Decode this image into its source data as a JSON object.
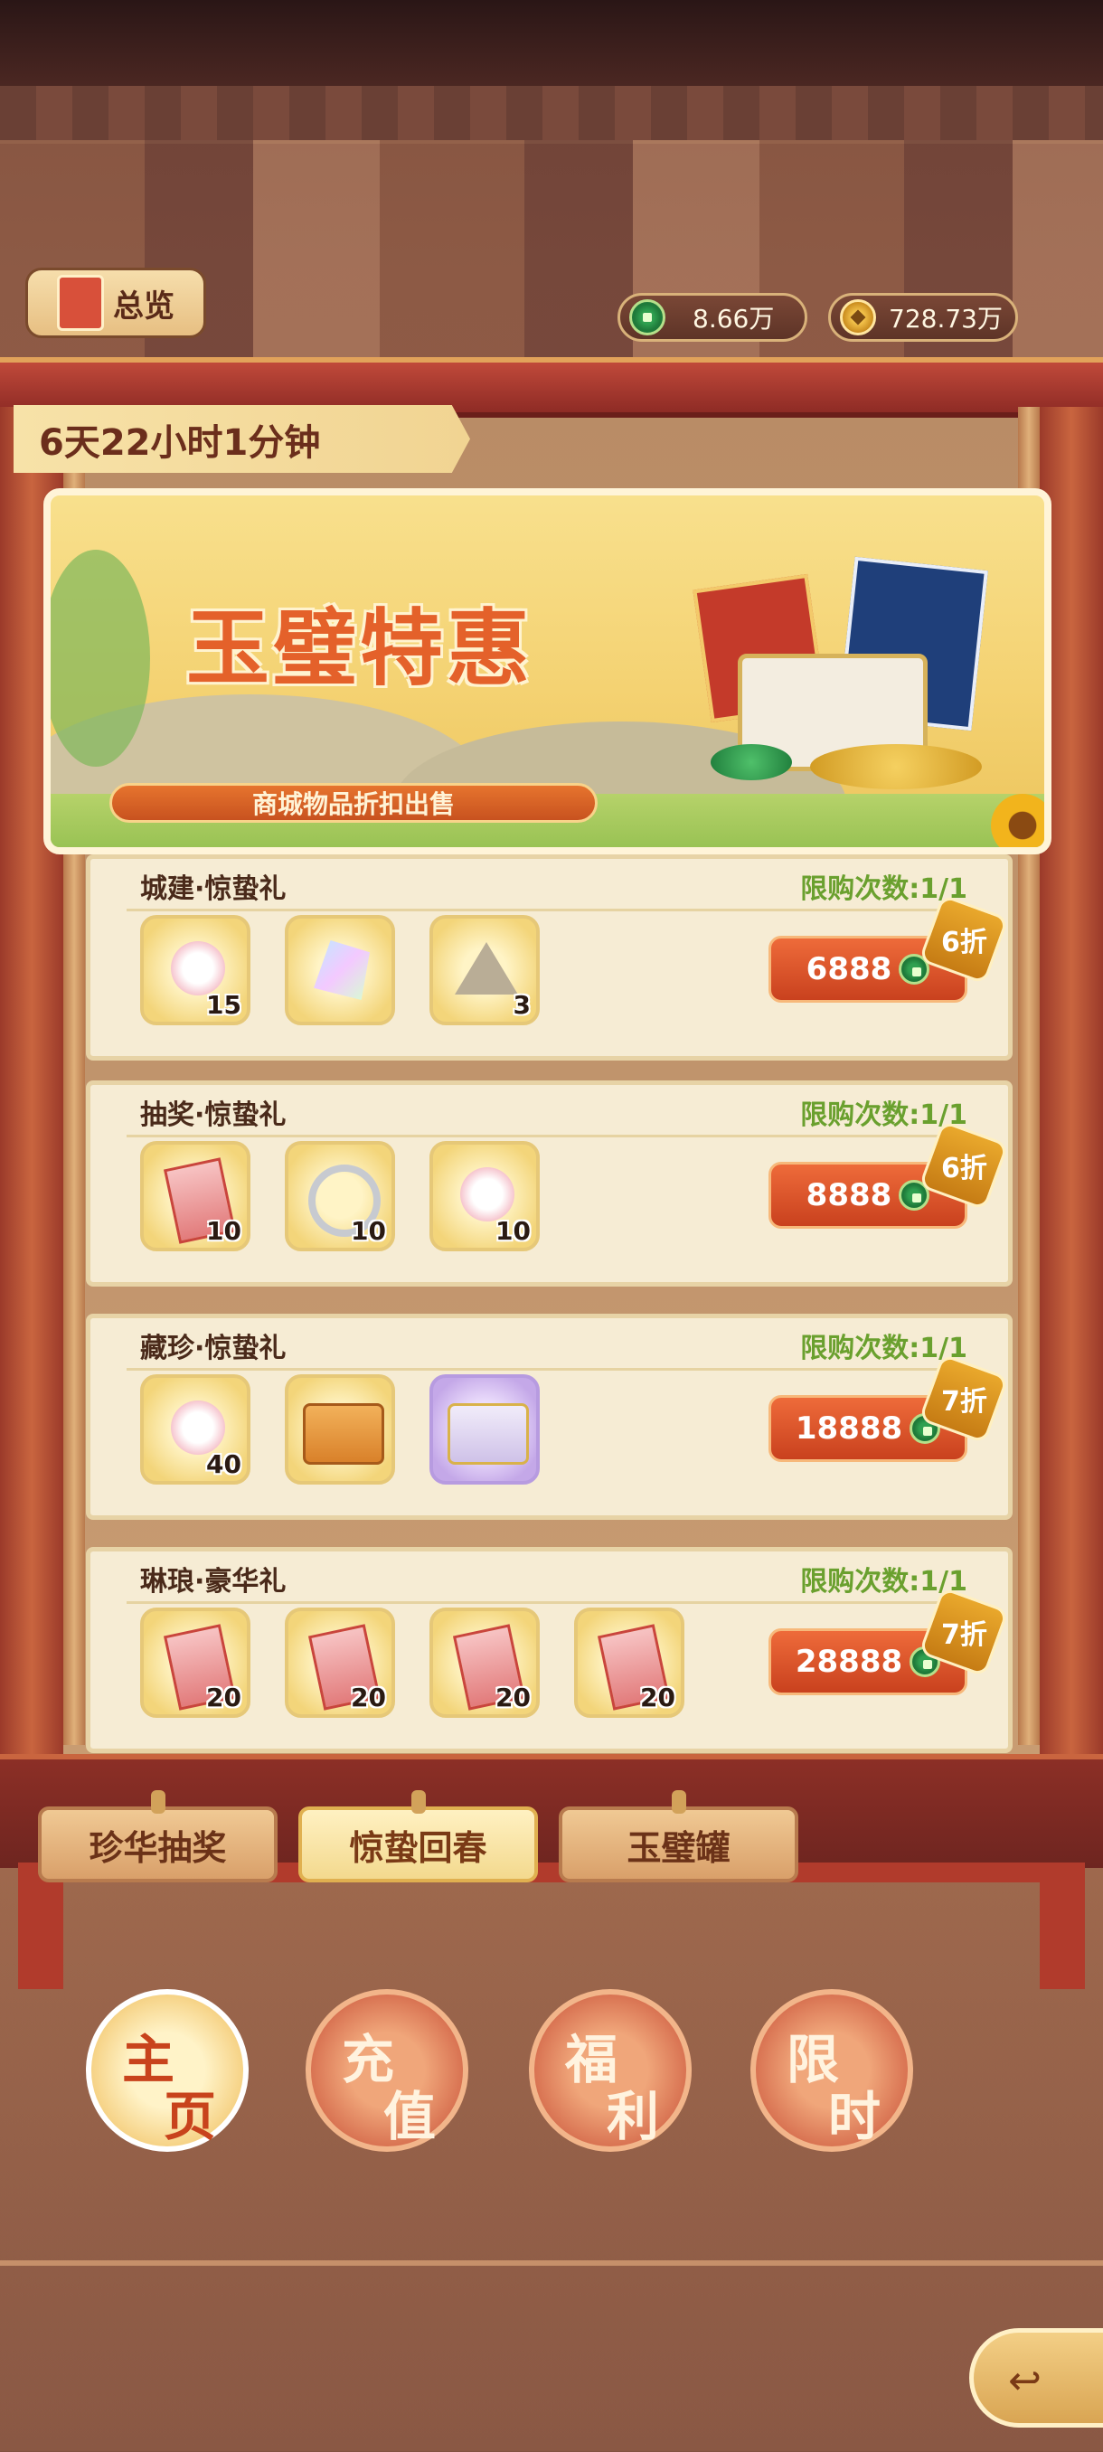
{
  "header": {
    "overview_label": "总览",
    "currency": [
      {
        "icon": "jade-coin-icon",
        "value": "8.66万"
      },
      {
        "icon": "copper-coin-icon",
        "value": "728.73万"
      }
    ]
  },
  "timer": "6天22小时1分钟",
  "banner": {
    "title": "玉璧特惠",
    "subtitle": "商城物品折扣出售"
  },
  "packs": [
    {
      "title": "城建·惊蛰礼",
      "limit": "限购次数:1/1",
      "price": "6888",
      "discount": "6折",
      "items": [
        {
          "icon": "cherry-blossom-icon",
          "qty": "15"
        },
        {
          "icon": "crystal-icon",
          "qty": ""
        },
        {
          "icon": "tent-icon",
          "qty": "3"
        }
      ]
    },
    {
      "title": "抽奖·惊蛰礼",
      "limit": "限购次数:1/1",
      "price": "8888",
      "discount": "6折",
      "items": [
        {
          "icon": "red-ticket-icon",
          "qty": "10"
        },
        {
          "icon": "silver-ring-icon",
          "qty": "10"
        },
        {
          "icon": "cherry-blossom-icon",
          "qty": "10"
        }
      ]
    },
    {
      "title": "藏珍·惊蛰礼",
      "limit": "限购次数:1/1",
      "price": "18888",
      "discount": "7折",
      "items": [
        {
          "icon": "cherry-blossom-icon",
          "qty": "40"
        },
        {
          "icon": "orange-chest-icon",
          "qty": ""
        },
        {
          "icon": "purple-chest-icon",
          "qty": ""
        }
      ]
    },
    {
      "title": "琳琅·豪华礼",
      "limit": "限购次数:1/1",
      "price": "28888",
      "discount": "7折",
      "items": [
        {
          "icon": "red-ticket-icon",
          "qty": "20"
        },
        {
          "icon": "red-ticket-icon",
          "qty": "20"
        },
        {
          "icon": "red-ticket-icon",
          "qty": "20"
        },
        {
          "icon": "red-ticket-icon",
          "qty": "20"
        }
      ]
    }
  ],
  "tabs": [
    "珍华抽奖",
    "惊蛰回春",
    "玉璧罐"
  ],
  "active_tab": 1,
  "nav": [
    {
      "c1": "主",
      "c2": "页"
    },
    {
      "c1": "充",
      "c2": "值"
    },
    {
      "c1": "福",
      "c2": "利"
    },
    {
      "c1": "限",
      "c2": "时"
    }
  ],
  "colors": {
    "accent": "#e4612a",
    "limit_green": "#6aa02e",
    "price_red": "#d9502a"
  }
}
